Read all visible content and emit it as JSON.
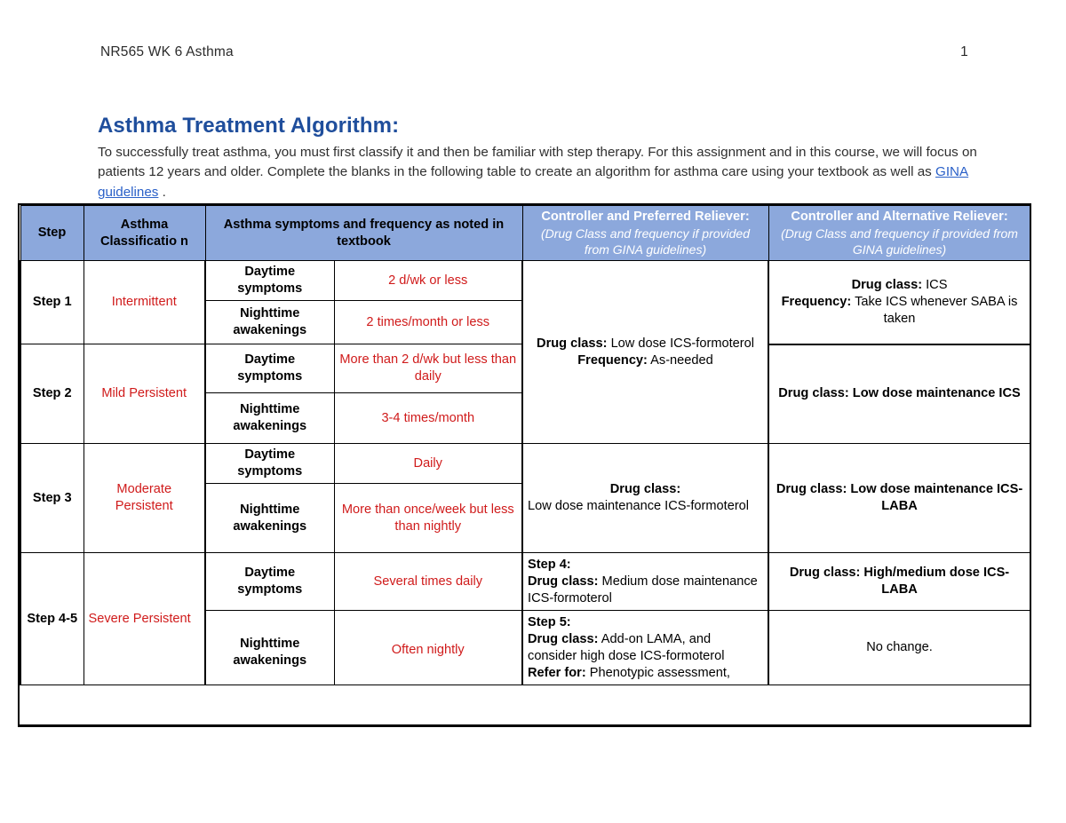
{
  "header": {
    "course_label": "NR565 WK 6 Asthma",
    "page_number": "1"
  },
  "title": "Asthma Treatment Algorithm:",
  "intro": {
    "part1": "To successfully treat asthma, you must first classify it and then be familiar with step therapy.  For this assignment and in this course, we will focus on patients 12 years and older. Complete the blanks in the following table to create an algorithm for asthma care using your textbook as well as ",
    "link_text": "GINA guidelines",
    "part2": " ."
  },
  "table": {
    "columns": {
      "step": "Step",
      "classification": "Asthma Classificatio n",
      "symptoms": "Asthma symptoms and frequency as noted in textbook",
      "preferred_title": "Controller and Preferred Reliever:",
      "preferred_sub": "(Drug Class and frequency if provided from GINA guidelines)",
      "alternative_title": "Controller and Alternative Reliever:",
      "alternative_sub": "(Drug Class and frequency if provided from GINA guidelines)"
    },
    "labels": {
      "daytime": "Daytime symptoms",
      "nighttime": "Nighttime awakenings"
    },
    "rows": [
      {
        "step": "Step 1",
        "classification": "Intermittent",
        "daytime_value": "2 d/wk or less",
        "nighttime_value": "2 times/month or less"
      },
      {
        "step": "Step 2",
        "classification": "Mild Persistent",
        "daytime_value": "More than 2 d/wk but less than daily",
        "nighttime_value": "3-4 times/month"
      },
      {
        "step": "Step 3",
        "classification": "Moderate Persistent",
        "daytime_value": "Daily",
        "nighttime_value": "More than once/week but less than nightly"
      },
      {
        "step": "Step 4-5",
        "classification": "Severe Persistent",
        "daytime_value": "Several times daily",
        "nighttime_value": "Often nightly"
      }
    ],
    "preferred": {
      "step12": {
        "drug_label": "Drug class:",
        "drug_value": " Low dose ICS-formoterol",
        "freq_label": "Frequency:",
        "freq_value": " As-needed"
      },
      "step3": {
        "drug_label": "Drug class:",
        "drug_value": "Low dose maintenance ICS-formoterol"
      },
      "step4": {
        "step_label": "Step 4:",
        "drug_label": "Drug class:",
        "drug_value": " Medium dose maintenance ICS-formoterol"
      },
      "step5": {
        "step_label": "Step 5:",
        "drug_label": "Drug class:",
        "drug_value": " Add-on LAMA, and consider high dose ICS-formoterol",
        "refer_label": "Refer for:",
        "refer_value": " Phenotypic assessment,"
      }
    },
    "alternative": {
      "step1": {
        "drug_label": "Drug class:",
        "drug_value": " ICS",
        "freq_label": "Frequency:",
        "freq_value": " Take ICS whenever SABA is taken"
      },
      "step2": "Drug class: Low dose maintenance ICS",
      "step3": "Drug class: Low dose maintenance ICS-LABA",
      "step4": "Drug class: High/medium dose ICS-LABA",
      "step5": "No change."
    }
  },
  "colors": {
    "header_fill": "#8CA8DC",
    "row_separator": "#3D5C9E",
    "answer_text": "#D01B1B",
    "title_blue": "#1F4E9C",
    "link_blue": "#2A60C8"
  }
}
